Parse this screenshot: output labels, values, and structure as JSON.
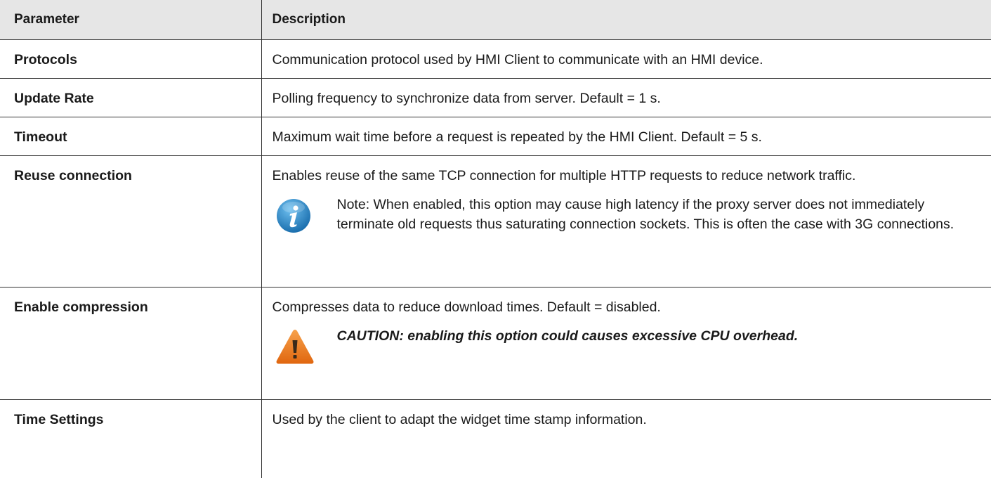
{
  "header": {
    "parameter": "Parameter",
    "description": "Description"
  },
  "rows": [
    {
      "param": "Protocols",
      "desc": "Communication protocol used by HMI Client to communicate with an HMI device."
    },
    {
      "param": "Update Rate",
      "desc": "Polling frequency to synchronize data from server. Default = 1 s."
    },
    {
      "param": "Timeout",
      "desc": "Maximum wait time before a request is repeated by the HMI Client. Default = 5 s."
    },
    {
      "param": "Reuse connection",
      "desc": "Enables reuse of the same TCP connection for multiple HTTP requests to reduce network traffic.",
      "note": {
        "icon": "info-icon",
        "text": "Note: When enabled, this option may cause high latency if the proxy server does not immediately terminate old requests thus saturating connection sockets. This is often the case with 3G connections."
      }
    },
    {
      "param": "Enable compression",
      "desc": "Compresses data to reduce download times. Default = disabled.",
      "note": {
        "icon": "warning-icon",
        "text": "CAUTION: enabling this option could causes excessive CPU overhead."
      }
    },
    {
      "param": "Time Settings",
      "desc": "Used by the client to adapt the widget time stamp information."
    }
  ],
  "colors": {
    "header_bg": "#e6e6e6",
    "info_blue": "#2a86c8",
    "warning_orange": "#ef7f1a"
  }
}
